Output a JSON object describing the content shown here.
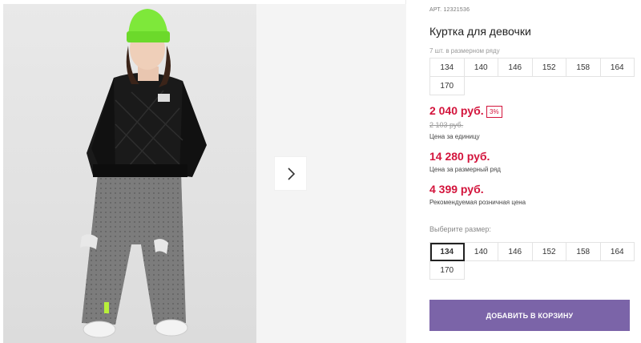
{
  "gallery": {
    "next_icon": "chevron-right-icon",
    "photo_alt": "Куртка для девочки"
  },
  "product": {
    "sku_label": "АРТ.",
    "sku_value": "12321536",
    "title": "Куртка для девочки",
    "row_note": "7 шт. в размерном ряду",
    "row_sizes": [
      "134",
      "140",
      "146",
      "152",
      "158",
      "164",
      "170"
    ],
    "price_unit": "2 040 руб.",
    "discount": "3%",
    "price_old": "2 103 руб.",
    "price_unit_caption": "Цена за единицу",
    "price_row": "14 280 руб.",
    "price_row_caption": "Цена за размерный ряд",
    "price_rrp": "4 399 руб.",
    "price_rrp_caption": "Рекомендуемая розничная цена",
    "choose_label": "Выберите размер:",
    "select_sizes": [
      "134",
      "140",
      "146",
      "152",
      "158",
      "164",
      "170"
    ],
    "selected_size": "134",
    "add_to_cart": "ДОБАВИТЬ В КОРЗИНУ"
  },
  "colors": {
    "price": "#d3143c",
    "button": "#7b64a8"
  }
}
